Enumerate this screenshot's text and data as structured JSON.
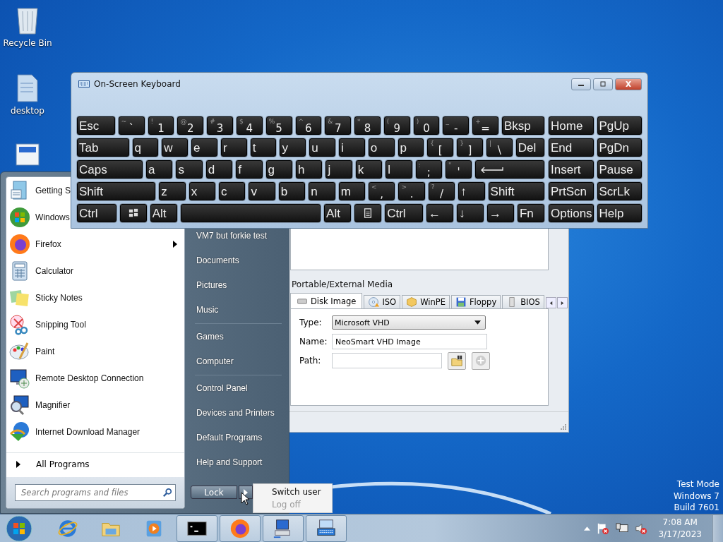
{
  "desktop_icons": [
    {
      "label": "Recycle Bin",
      "kind": "recycle"
    },
    {
      "label": "desktop",
      "kind": "file"
    },
    {
      "kind": "app"
    }
  ],
  "keyboard": {
    "title": "On-Screen Keyboard",
    "key_rows": [
      {
        "keys": [
          {
            "label": "Esc",
            "kind": "named"
          },
          {
            "label": "`",
            "shift": "~",
            "kind": "char"
          },
          {
            "label": "1",
            "shift": "!",
            "kind": "char"
          },
          {
            "label": "2",
            "shift": "@",
            "kind": "char"
          },
          {
            "label": "3",
            "shift": "#",
            "kind": "char"
          },
          {
            "label": "4",
            "shift": "$",
            "kind": "char"
          },
          {
            "label": "5",
            "shift": "%",
            "kind": "char"
          },
          {
            "label": "6",
            "shift": "^",
            "kind": "char"
          },
          {
            "label": "7",
            "shift": "&",
            "kind": "char"
          },
          {
            "label": "8",
            "shift": "*",
            "kind": "char"
          },
          {
            "label": "9",
            "shift": "(",
            "kind": "char"
          },
          {
            "label": "0",
            "shift": ")",
            "kind": "char"
          },
          {
            "label": "-",
            "shift": "_",
            "kind": "char"
          },
          {
            "label": "=",
            "shift": "+",
            "kind": "char"
          },
          {
            "label": "Bksp",
            "kind": "named"
          }
        ]
      },
      {
        "keys": [
          {
            "label": "Tab",
            "kind": "named"
          },
          {
            "label": "q",
            "kind": "named"
          },
          {
            "label": "w",
            "kind": "named"
          },
          {
            "label": "e",
            "kind": "named"
          },
          {
            "label": "r",
            "kind": "named"
          },
          {
            "label": "t",
            "kind": "named"
          },
          {
            "label": "y",
            "kind": "named"
          },
          {
            "label": "u",
            "kind": "named"
          },
          {
            "label": "i",
            "kind": "named"
          },
          {
            "label": "o",
            "kind": "named"
          },
          {
            "label": "p",
            "kind": "named"
          },
          {
            "label": "[",
            "shift": "{",
            "kind": "char"
          },
          {
            "label": "]",
            "shift": "}",
            "kind": "char"
          },
          {
            "label": "\\",
            "shift": "|",
            "kind": "char"
          },
          {
            "label": "Del",
            "kind": "named"
          }
        ]
      },
      {
        "keys": [
          {
            "label": "Caps",
            "kind": "named"
          },
          {
            "label": "a",
            "kind": "named"
          },
          {
            "label": "s",
            "kind": "named"
          },
          {
            "label": "d",
            "kind": "named"
          },
          {
            "label": "f",
            "kind": "named"
          },
          {
            "label": "g",
            "kind": "named"
          },
          {
            "label": "h",
            "kind": "named"
          },
          {
            "label": "j",
            "kind": "named"
          },
          {
            "label": "k",
            "kind": "named"
          },
          {
            "label": "l",
            "kind": "named"
          },
          {
            "label": ";",
            "shift": ":",
            "kind": "char"
          },
          {
            "label": "'",
            "shift": "\"",
            "kind": "char"
          },
          {
            "kind": "enter"
          }
        ]
      },
      {
        "keys": [
          {
            "label": "Shift",
            "kind": "named"
          },
          {
            "label": "z",
            "kind": "named"
          },
          {
            "label": "x",
            "kind": "named"
          },
          {
            "label": "c",
            "kind": "named"
          },
          {
            "label": "v",
            "kind": "named"
          },
          {
            "label": "b",
            "kind": "named"
          },
          {
            "label": "n",
            "kind": "named"
          },
          {
            "label": "m",
            "kind": "named"
          },
          {
            "label": ",",
            "shift": "<",
            "kind": "char"
          },
          {
            "label": ".",
            "shift": ">",
            "kind": "char"
          },
          {
            "label": "/",
            "shift": "?",
            "kind": "char"
          },
          {
            "label": "↑",
            "kind": "named"
          },
          {
            "label": "Shift",
            "kind": "named"
          }
        ]
      },
      {
        "keys": [
          {
            "label": "Ctrl",
            "kind": "named"
          },
          {
            "kind": "windows"
          },
          {
            "label": "Alt",
            "kind": "named"
          },
          {
            "kind": "space"
          },
          {
            "label": "Alt",
            "kind": "named"
          },
          {
            "kind": "menu"
          },
          {
            "label": "Ctrl",
            "kind": "named"
          },
          {
            "label": "←",
            "kind": "named"
          },
          {
            "label": "↓",
            "kind": "named"
          },
          {
            "label": "→",
            "kind": "named"
          },
          {
            "label": "Fn",
            "kind": "named"
          }
        ]
      }
    ],
    "nav_keys": [
      {
        "keys": [
          {
            "label": "Home"
          },
          {
            "label": "PgUp"
          }
        ]
      },
      {
        "keys": [
          {
            "label": "End"
          },
          {
            "label": "PgDn"
          }
        ]
      },
      {
        "keys": [
          {
            "label": "Insert"
          },
          {
            "label": "Pause"
          }
        ]
      },
      {
        "keys": [
          {
            "label": "PrtScn"
          },
          {
            "label": "ScrLk"
          }
        ]
      },
      {
        "keys": [
          {
            "label": "Options"
          },
          {
            "label": "Help"
          }
        ]
      }
    ]
  },
  "app_window": {
    "group_label": "Portable/External Media",
    "tabs": [
      {
        "label": "Disk Image",
        "kind": "disk",
        "selected": true
      },
      {
        "label": "ISO",
        "kind": "cd",
        "selected": false
      },
      {
        "label": "WinPE",
        "kind": "cube",
        "selected": false
      },
      {
        "label": "Floppy",
        "kind": "floppy",
        "selected": false
      },
      {
        "label": "BIOS",
        "kind": "chip",
        "selected": false
      }
    ],
    "type_label": "Type:",
    "type_value": "Microsoft VHD",
    "name_label": "Name:",
    "name_value": "NeoSmart VHD Image",
    "path_label": "Path:"
  },
  "start_menu": {
    "programs": [
      {
        "label": "Getting S",
        "kind": "getting-started",
        "submenu": false
      },
      {
        "label": "Windows",
        "kind": "windows",
        "submenu": false
      },
      {
        "label": "Firefox",
        "kind": "firefox",
        "submenu": true
      },
      {
        "label": "Calculator",
        "kind": "calculator",
        "submenu": false
      },
      {
        "label": "Sticky Notes",
        "kind": "sticky",
        "submenu": false
      },
      {
        "label": "Snipping Tool",
        "kind": "snipping",
        "submenu": false
      },
      {
        "label": "Paint",
        "kind": "paint",
        "submenu": false
      },
      {
        "label": "Remote Desktop Connection",
        "kind": "remote",
        "submenu": false
      },
      {
        "label": "Magnifier",
        "kind": "magnifier",
        "submenu": false
      },
      {
        "label": "Internet Download Manager",
        "kind": "idm",
        "submenu": false
      }
    ],
    "all_programs": "All Programs",
    "search_placeholder": "Search programs and files",
    "places": [
      {
        "label": "VM7 but forkie test",
        "separator_after": false
      },
      {
        "label": "Documents",
        "separator_after": false
      },
      {
        "label": "Pictures",
        "separator_after": false
      },
      {
        "label": "Music",
        "separator_after": true
      },
      {
        "label": "Games",
        "separator_after": false
      },
      {
        "label": "Computer",
        "separator_after": true
      },
      {
        "label": "Control Panel",
        "separator_after": false
      },
      {
        "label": "Devices and Printers",
        "separator_after": false
      },
      {
        "label": "Default Programs",
        "separator_after": false
      },
      {
        "label": "Help and Support",
        "separator_after": false
      }
    ],
    "power_button": "Lock",
    "power_menu": [
      {
        "label": "Switch user",
        "disabled": false
      },
      {
        "label": "Log off",
        "disabled": true
      }
    ]
  },
  "test_mode": [
    "Test Mode",
    "Windows 7",
    "Build 7601"
  ],
  "taskbar": {
    "items": [
      {
        "kind": "ie",
        "running": false
      },
      {
        "kind": "explorer",
        "running": false
      },
      {
        "kind": "media",
        "running": false
      },
      {
        "kind": "cmd",
        "running": true
      },
      {
        "kind": "firefox",
        "running": true
      },
      {
        "kind": "network",
        "running": true
      },
      {
        "kind": "keyboard",
        "running": true
      }
    ],
    "time": "7:08 AM",
    "date": "3/17/2023"
  }
}
